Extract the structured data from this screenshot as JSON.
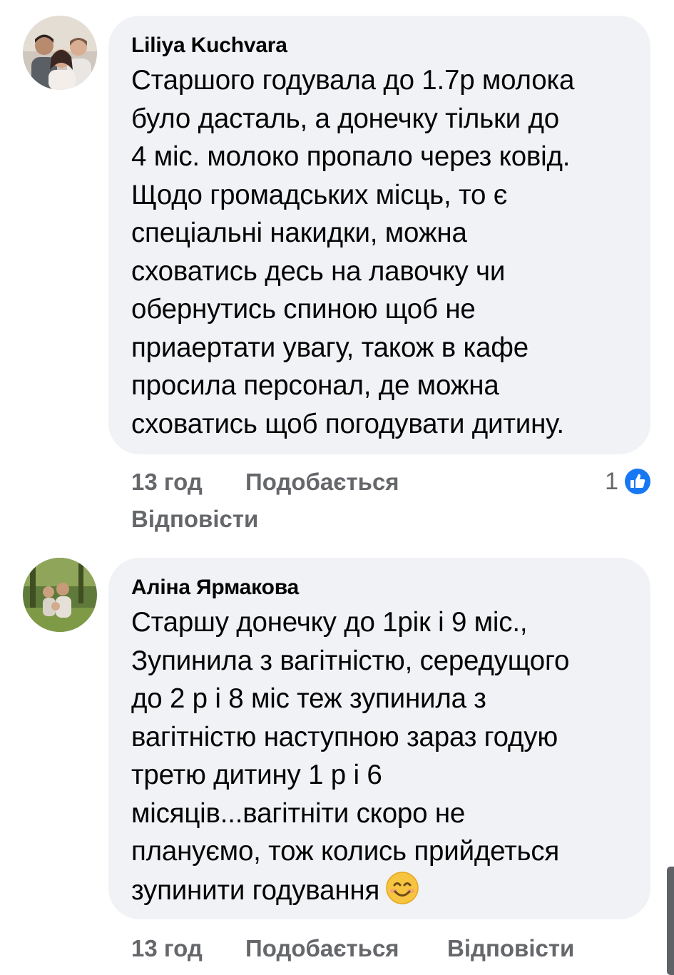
{
  "comments": [
    {
      "author": "Liliya Kuchvara",
      "lines": [
        "Старшого годувала до 1.7р молока",
        "було дасталь, а донечку тільки до",
        "4 міс. молоко пропало через ковід.",
        "Щодо громадських місць, то є",
        "спеціальні накидки, можна",
        "сховатись десь на лавочку чи",
        "обернутись спиною щоб не",
        "приаертати увагу, також в кафе",
        "просила персонал, де можна",
        "сховатись щоб погодувати дитину."
      ],
      "time": "13 год",
      "like_label": "Подобається",
      "reply_label": "Відповісти",
      "reaction_count": "1",
      "reaction_icon": "like-icon"
    },
    {
      "author": "Аліна Ярмакова",
      "lines": [
        "Старшу донечку до 1рік і 9 міс.,",
        "Зупинила з вагітністю, середущого",
        "до 2 р і 8 міс теж зупинила з",
        "вагітністю наступною зараз годую",
        "третю дитину 1 р і 6",
        "місяців...вагітніти скоро не",
        "плануємо, тож колись прийдеться",
        "зупинити годування"
      ],
      "emoji": "smiling-face-emoji",
      "time": "13 год",
      "like_label": "Подобається",
      "reply_label": "Відповісти"
    }
  ],
  "colors": {
    "bubble": "#f0f2f5",
    "text": "#050505",
    "secondary": "#65676b",
    "like_blue": "#1877f2"
  }
}
